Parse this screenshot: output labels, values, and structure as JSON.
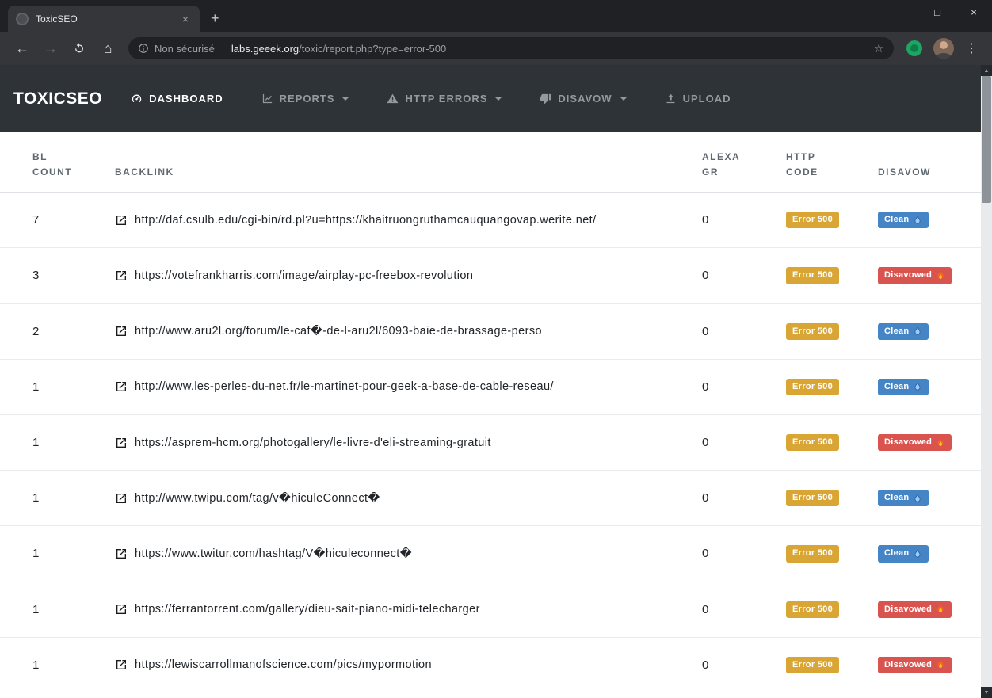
{
  "icons": {
    "tab_close": "×",
    "new_tab": "+",
    "minimize": "–",
    "maximize": "□",
    "close": "×",
    "back": "←",
    "forward": "→",
    "home": "⌂",
    "star": "☆",
    "menu": "⋮",
    "scroll_up": "▲",
    "scroll_down": "▼"
  },
  "colors": {
    "error_badge": "#d9a636",
    "clean_badge": "#4584c5",
    "disavowed_badge": "#d9534f",
    "navbar_bg": "#2e3338"
  },
  "browser": {
    "tab_title": "ToxicSEO",
    "security_label": "Non sécurisé",
    "url_host": "labs.geeek.org",
    "url_path": "/toxic/report.php?type=error-500"
  },
  "navbar": {
    "brand": "TOXICSEO",
    "items": [
      {
        "label": "DASHBOARD",
        "icon": "dashboard-icon",
        "active": true,
        "dropdown": false
      },
      {
        "label": "REPORTS",
        "icon": "reports-chart-icon",
        "active": false,
        "dropdown": true
      },
      {
        "label": "HTTP ERRORS",
        "icon": "warning-triangle-icon",
        "active": false,
        "dropdown": true
      },
      {
        "label": "DISAVOW",
        "icon": "thumbs-down-icon",
        "active": false,
        "dropdown": true
      },
      {
        "label": "UPLOAD",
        "icon": "upload-icon",
        "active": false,
        "dropdown": false
      }
    ]
  },
  "table": {
    "headers": [
      "BL\nCOUNT",
      "BACKLINK",
      "ALEXA\nGR",
      "HTTP\nCODE",
      "DISAVOW"
    ],
    "rows": [
      {
        "bl_count": "7",
        "backlink": "http://daf.csulb.edu/cgi-bin/rd.pl?u=https://khaitruongruthamcauquangovap.werite.net/",
        "alexa_gr": "0",
        "http_code": "Error 500",
        "disavow_label": "Clean",
        "disavow_state": "clean"
      },
      {
        "bl_count": "3",
        "backlink": "https://votefrankharris.com/image/airplay-pc-freebox-revolution",
        "alexa_gr": "0",
        "http_code": "Error 500",
        "disavow_label": "Disavowed",
        "disavow_state": "disavowed"
      },
      {
        "bl_count": "2",
        "backlink": "http://www.aru2l.org/forum/le-caf�-de-l-aru2l/6093-baie-de-brassage-perso",
        "alexa_gr": "0",
        "http_code": "Error 500",
        "disavow_label": "Clean",
        "disavow_state": "clean"
      },
      {
        "bl_count": "1",
        "backlink": "http://www.les-perles-du-net.fr/le-martinet-pour-geek-a-base-de-cable-reseau/",
        "alexa_gr": "0",
        "http_code": "Error 500",
        "disavow_label": "Clean",
        "disavow_state": "clean"
      },
      {
        "bl_count": "1",
        "backlink": "https://asprem-hcm.org/photogallery/le-livre-d'eli-streaming-gratuit",
        "alexa_gr": "0",
        "http_code": "Error 500",
        "disavow_label": "Disavowed",
        "disavow_state": "disavowed"
      },
      {
        "bl_count": "1",
        "backlink": "http://www.twipu.com/tag/v�hiculeConnect�",
        "alexa_gr": "0",
        "http_code": "Error 500",
        "disavow_label": "Clean",
        "disavow_state": "clean"
      },
      {
        "bl_count": "1",
        "backlink": "https://www.twitur.com/hashtag/V�hiculeconnect�",
        "alexa_gr": "0",
        "http_code": "Error 500",
        "disavow_label": "Clean",
        "disavow_state": "clean"
      },
      {
        "bl_count": "1",
        "backlink": "https://ferrantorrent.com/gallery/dieu-sait-piano-midi-telecharger",
        "alexa_gr": "0",
        "http_code": "Error 500",
        "disavow_label": "Disavowed",
        "disavow_state": "disavowed"
      },
      {
        "bl_count": "1",
        "backlink": "https://lewiscarrollmanofscience.com/pics/mypormotion",
        "alexa_gr": "0",
        "http_code": "Error 500",
        "disavow_label": "Disavowed",
        "disavow_state": "disavowed"
      }
    ]
  }
}
